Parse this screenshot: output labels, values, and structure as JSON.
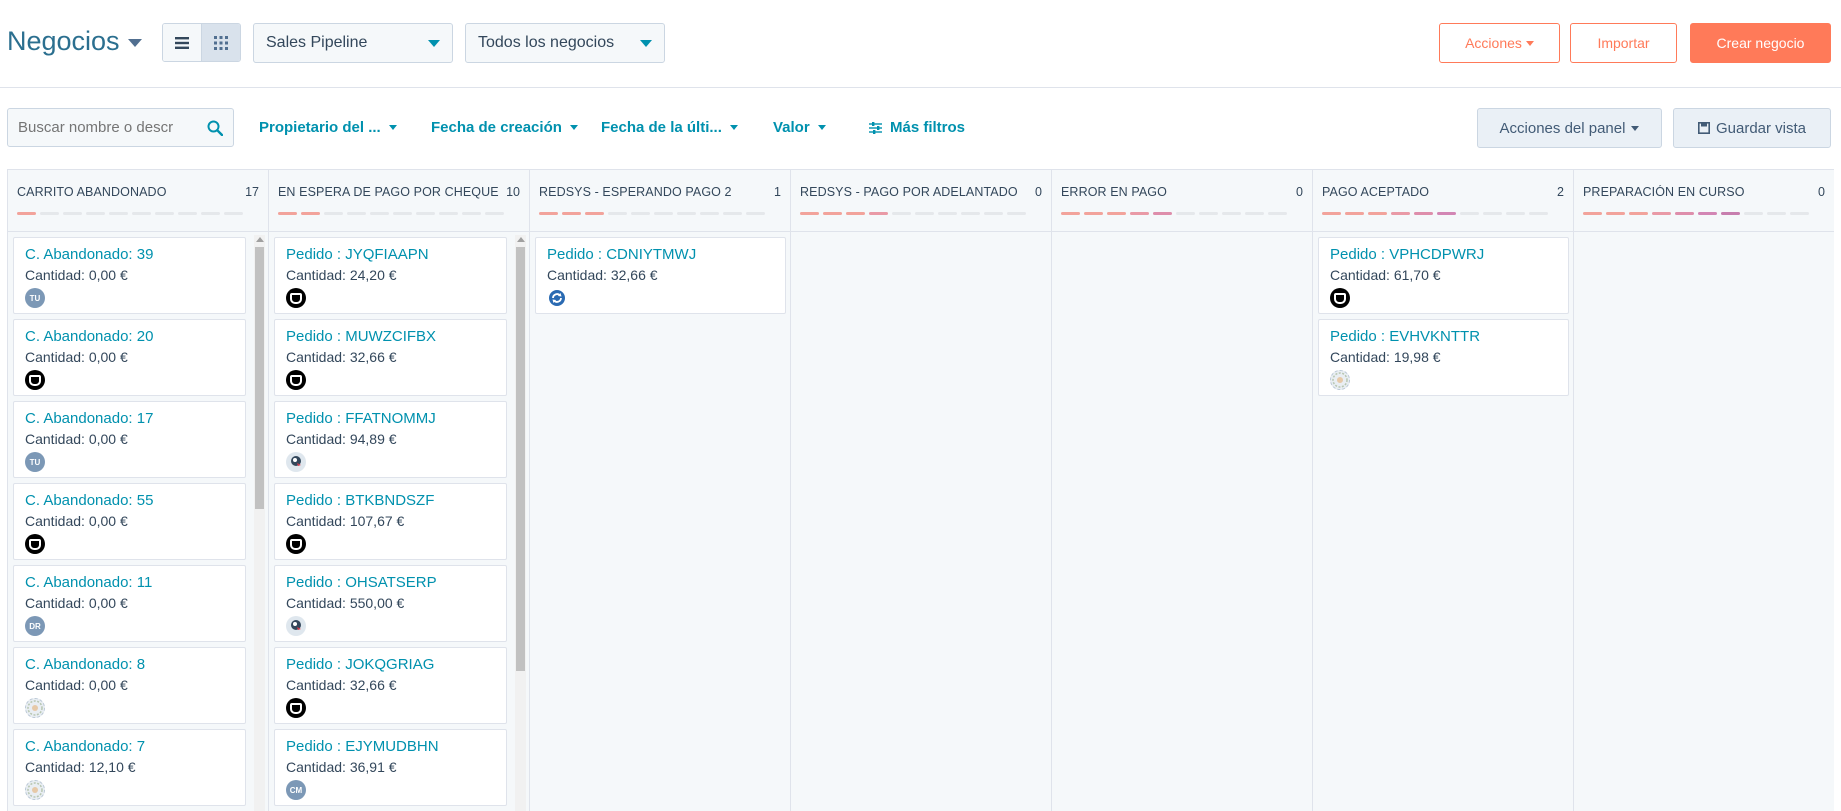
{
  "header": {
    "title": "Negocios",
    "pipeline_select": "Sales Pipeline",
    "deals_select": "Todos los negocios",
    "actions_label": "Acciones",
    "import_label": "Importar",
    "create_label": "Crear negocio"
  },
  "filters": {
    "search_placeholder": "Buscar nombre o descr",
    "owner": "Propietario del ...",
    "created": "Fecha de creación",
    "last": "Fecha de la últi...",
    "value": "Valor",
    "more": "Más filtros",
    "panel_actions": "Acciones del panel",
    "save_view": "Guardar vista"
  },
  "colors": {
    "accent": "#0091ae",
    "primary": "#ff7a59",
    "progress_active": [
      "#f2a39b",
      "#f2a39b",
      "#f2a39b",
      "#e99aa6",
      "#de8eab",
      "#d286b4",
      "#c77eae"
    ]
  },
  "columns": [
    {
      "name": "CARRITO ABANDONADO",
      "count": "17",
      "progress": 1,
      "cards": [
        {
          "title": "C. Abandonado: 39",
          "amount": "Cantidad: 0,00 €",
          "owner": "tu",
          "owner_text": "TU"
        },
        {
          "title": "C. Abandonado: 20",
          "amount": "Cantidad: 0,00 €",
          "owner": "ot",
          "owner_text": ""
        },
        {
          "title": "C. Abandonado: 17",
          "amount": "Cantidad: 0,00 €",
          "owner": "tu",
          "owner_text": "TU"
        },
        {
          "title": "C. Abandonado: 55",
          "amount": "Cantidad: 0,00 €",
          "owner": "ot",
          "owner_text": ""
        },
        {
          "title": "C. Abandonado: 11",
          "amount": "Cantidad: 0,00 €",
          "owner": "dr",
          "owner_text": "DR"
        },
        {
          "title": "C. Abandonado: 8",
          "amount": "Cantidad: 0,00 €",
          "owner": "logo",
          "owner_text": ""
        },
        {
          "title": "C. Abandonado: 7",
          "amount": "Cantidad: 12,10 €",
          "owner": "logo",
          "owner_text": ""
        }
      ]
    },
    {
      "name": "EN ESPERA DE PAGO POR CHEQUE",
      "count": "10",
      "progress": 2,
      "cards": [
        {
          "title": "Pedido : JYQFIAAPN",
          "amount": "Cantidad: 24,20 €",
          "owner": "ot",
          "owner_text": ""
        },
        {
          "title": "Pedido : MUWZCIFBX",
          "amount": "Cantidad: 32,66 €",
          "owner": "ot",
          "owner_text": ""
        },
        {
          "title": "Pedido : FFATNOMMJ",
          "amount": "Cantidad: 94,89 €",
          "owner": "guest",
          "owner_text": ""
        },
        {
          "title": "Pedido : BTKBNDSZF",
          "amount": "Cantidad: 107,67 €",
          "owner": "ot",
          "owner_text": ""
        },
        {
          "title": "Pedido : OHSATSERP",
          "amount": "Cantidad: 550,00 €",
          "owner": "guest",
          "owner_text": ""
        },
        {
          "title": "Pedido : JOKQGRIAG",
          "amount": "Cantidad: 32,66 €",
          "owner": "ot",
          "owner_text": ""
        },
        {
          "title": "Pedido : EJYMUDBHN",
          "amount": "Cantidad: 36,91 €",
          "owner": "cm",
          "owner_text": "CM"
        }
      ]
    },
    {
      "name": "REDSYS - ESPERANDO PAGO 2",
      "count": "1",
      "progress": 3,
      "cards": [
        {
          "title": "Pedido : CDNIYTMWJ",
          "amount": "Cantidad: 32,66 €",
          "owner": "sync",
          "owner_text": ""
        }
      ]
    },
    {
      "name": "REDSYS - PAGO POR ADELANTADO",
      "count": "0",
      "progress": 4,
      "cards": []
    },
    {
      "name": "ERROR EN PAGO",
      "count": "0",
      "progress": 5,
      "cards": []
    },
    {
      "name": "PAGO ACEPTADO",
      "count": "2",
      "progress": 6,
      "cards": [
        {
          "title": "Pedido : VPHCDPWRJ",
          "amount": "Cantidad: 61,70 €",
          "owner": "ot",
          "owner_text": ""
        },
        {
          "title": "Pedido : EVHVKNTTR",
          "amount": "Cantidad: 19,98 €",
          "owner": "logo",
          "owner_text": ""
        }
      ]
    },
    {
      "name": "PREPARACIÓN EN CURSO",
      "count": "0",
      "progress": 7,
      "cards": []
    }
  ]
}
